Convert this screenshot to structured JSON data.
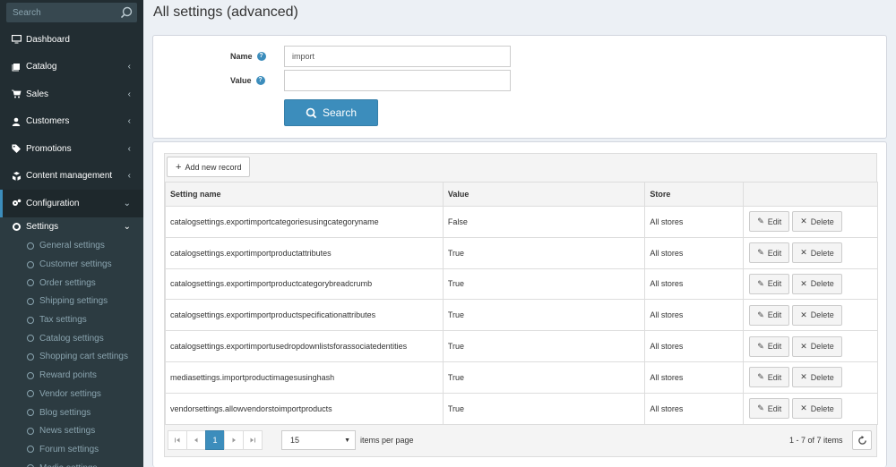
{
  "sidebar": {
    "search_placeholder": "Search",
    "items": [
      {
        "label": "Dashboard",
        "icon": "desktop-icon",
        "chevron": ""
      },
      {
        "label": "Catalog",
        "icon": "book-icon",
        "chevron": "‹"
      },
      {
        "label": "Sales",
        "icon": "cart-icon",
        "chevron": "‹"
      },
      {
        "label": "Customers",
        "icon": "user-icon",
        "chevron": "‹"
      },
      {
        "label": "Promotions",
        "icon": "tags-icon",
        "chevron": "‹"
      },
      {
        "label": "Content management",
        "icon": "cubes-icon",
        "chevron": "‹"
      },
      {
        "label": "Configuration",
        "icon": "gears-icon",
        "chevron": "⌄"
      }
    ],
    "settings_label": "Settings",
    "settings_chevron": "⌄",
    "sub_items": [
      "General settings",
      "Customer settings",
      "Order settings",
      "Shipping settings",
      "Tax settings",
      "Catalog settings",
      "Shopping cart settings",
      "Reward points",
      "Vendor settings",
      "Blog settings",
      "News settings",
      "Forum settings",
      "Media settings"
    ]
  },
  "page": {
    "title": "All settings (advanced)"
  },
  "search_form": {
    "name_label": "Name",
    "value_label": "Value",
    "name_value": "import",
    "value_value": "",
    "search_button": "Search"
  },
  "grid": {
    "add_button": "Add new record",
    "columns": [
      "Setting name",
      "Value",
      "Store",
      ""
    ],
    "rows": [
      {
        "name": "catalogsettings.exportimportcategoriesusingcategoryname",
        "value": "False",
        "store": "All stores"
      },
      {
        "name": "catalogsettings.exportimportproductattributes",
        "value": "True",
        "store": "All stores"
      },
      {
        "name": "catalogsettings.exportimportproductcategorybreadcrumb",
        "value": "True",
        "store": "All stores"
      },
      {
        "name": "catalogsettings.exportimportproductspecificationattributes",
        "value": "True",
        "store": "All stores"
      },
      {
        "name": "catalogsettings.exportimportusedropdownlistsforassociatedentities",
        "value": "True",
        "store": "All stores"
      },
      {
        "name": "mediasettings.importproductimagesusinghash",
        "value": "True",
        "store": "All stores"
      },
      {
        "name": "vendorsettings.allowvendorstoimportproducts",
        "value": "True",
        "store": "All stores"
      }
    ],
    "edit_label": "Edit",
    "delete_label": "Delete",
    "pager": {
      "current_page": "1",
      "page_size": "15",
      "items_per_page": "items per page",
      "range_text": "1 - 7 of 7 items"
    }
  },
  "colors": {
    "accent": "#3c8dbc",
    "sidebar_bg": "#222d32"
  }
}
